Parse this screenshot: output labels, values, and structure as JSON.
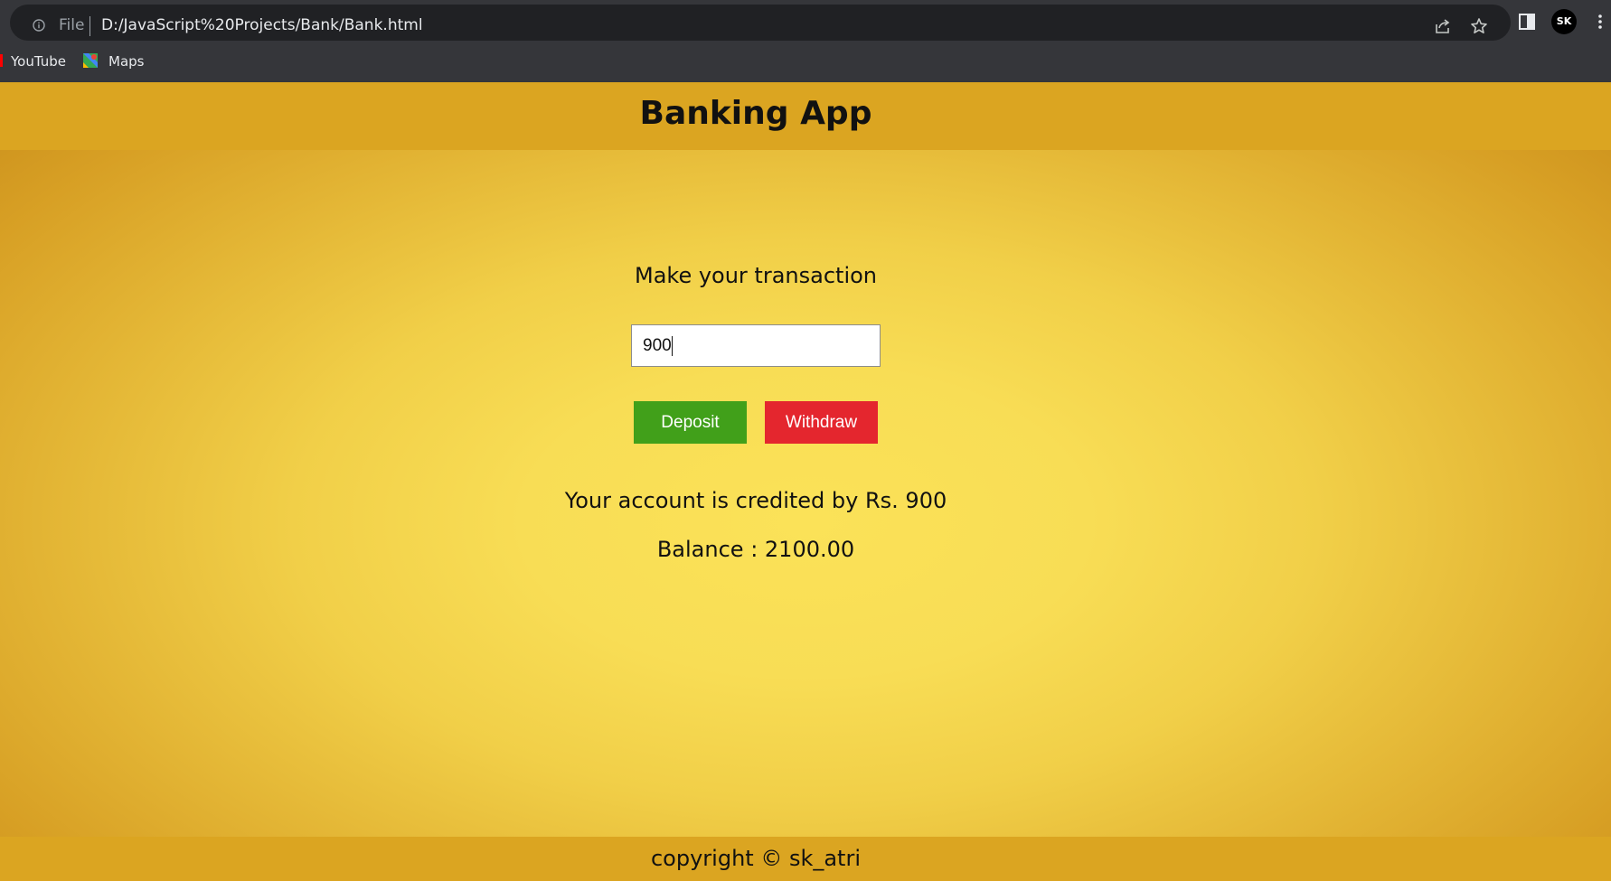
{
  "browser": {
    "file_label": "File",
    "url": "D:/JavaScript%20Projects/Bank/Bank.html",
    "profile_initials": "SK",
    "bookmarks": [
      {
        "label": "YouTube",
        "icon": "youtube-icon"
      },
      {
        "label": "Maps",
        "icon": "maps-icon"
      }
    ]
  },
  "app": {
    "title": "Banking App",
    "prompt": "Make your transaction",
    "amount_value": "900",
    "deposit_label": "Deposit",
    "withdraw_label": "Withdraw",
    "message": "Your account is credited by Rs. 900",
    "balance": "Balance : 2100.00",
    "footer": "copyright © sk_atri"
  },
  "colors": {
    "header_bg": "#dba521",
    "page_bg": "#f8dd55",
    "deposit": "#41a01a",
    "withdraw": "#e4262e",
    "browser_bg": "#35363a"
  }
}
